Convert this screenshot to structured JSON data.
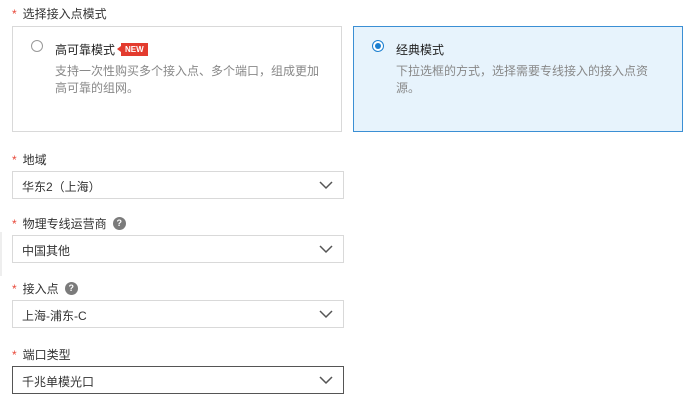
{
  "access_mode": {
    "label": "选择接入点模式",
    "options": [
      {
        "title": "高可靠模式",
        "badge": "NEW",
        "desc": "支持一次性购买多个接入点、多个端口，组成更加高可靠的组网。",
        "selected": false
      },
      {
        "title": "经典模式",
        "desc": "下拉选框的方式，选择需要专线接入的接入点资源。",
        "selected": true
      }
    ]
  },
  "region": {
    "label": "地域",
    "value": "华东2（上海）"
  },
  "carrier": {
    "label": "物理专线运营商",
    "value": "中国其他",
    "help": "?"
  },
  "access_point": {
    "label": "接入点",
    "value": "上海-浦东-C",
    "help": "?"
  },
  "port_type": {
    "label": "端口类型",
    "value": "千兆单模光口"
  },
  "required_mark": "*",
  "colors": {
    "accent": "#1b7fd0",
    "required": "#e8483a",
    "selected_bg": "#e7f3fc",
    "badge": "#e33b2e"
  }
}
